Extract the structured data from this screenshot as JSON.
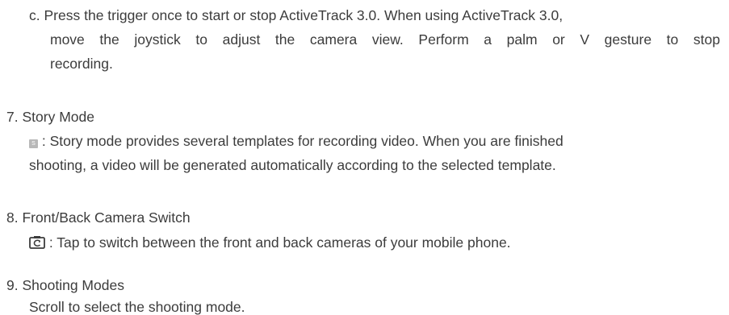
{
  "step_c": {
    "marker": "c.",
    "line1": "Press the trigger once to start or stop ActiveTrack 3.0. When using ActiveTrack 3.0,",
    "line2": "move the joystick to adjust the camera view. Perform a palm or V gesture to stop",
    "line3": "recording."
  },
  "item7": {
    "number": "7.",
    "title": "Story Mode",
    "icon_name": "story-mode-icon",
    "icon_letter": "S",
    "line1": ": Story mode provides several templates for recording video. When you are finished",
    "line2": "shooting, a video will be generated automatically according to the selected template."
  },
  "item8": {
    "number": "8.",
    "title": "Front/Back Camera Switch",
    "icon_name": "camera-switch-icon",
    "line1": ": Tap to switch between the front and back cameras of your mobile phone."
  },
  "item9": {
    "number": "9.",
    "title": "Shooting Modes",
    "line1": "Scroll to select the shooting mode."
  }
}
